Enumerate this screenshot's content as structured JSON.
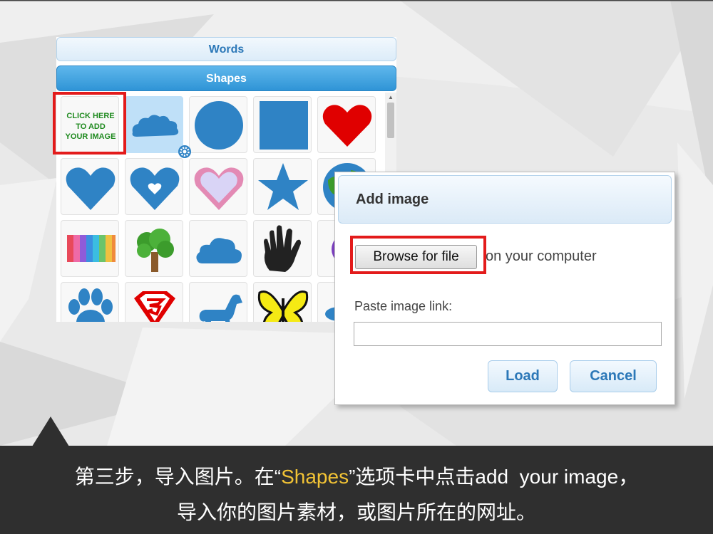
{
  "shapes_panel": {
    "tabs": [
      {
        "label": "Words",
        "active": false
      },
      {
        "label": "Shapes",
        "active": true
      }
    ],
    "add_image_tile": {
      "lines": [
        "CLICK HERE",
        "TO ADD",
        "YOUR IMAGE"
      ]
    },
    "shapes": [
      "add-image",
      "cloud",
      "circle",
      "square",
      "heart",
      "heart",
      "heart-with-small-heart",
      "heart-outline",
      "star",
      "globe",
      "rainbow-stripes",
      "tree",
      "cloud",
      "hand",
      "partial",
      "paw",
      "superman-logo",
      "horse",
      "butterfly",
      "partial"
    ],
    "selected_shape": "cloud",
    "colors": {
      "shape_blue": "#2f83c5",
      "heart_red": "#e00000"
    }
  },
  "dialog": {
    "title": "Add image",
    "browse_button": "Browse for file",
    "browse_suffix": "on your computer",
    "paste_label": "Paste image link:",
    "link_value": "",
    "load_button": "Load",
    "cancel_button": "Cancel"
  },
  "caption": {
    "line1_before": "第三步，导入图片。在“",
    "line1_highlight": "Shapes",
    "line1_after": "”选项卡中点击add  your image，",
    "line2": "导入你的图片素材，或图片所在的网址。"
  },
  "colors": {
    "highlight": "#e31b1b",
    "caption_bg": "#2f2f2f",
    "caption_highlight": "#f2c335"
  }
}
